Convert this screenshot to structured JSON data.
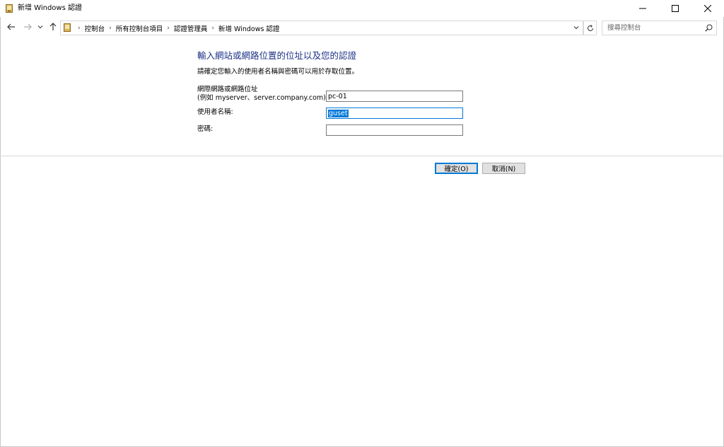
{
  "window": {
    "title": "新增 Windows 認證"
  },
  "nav": {
    "breadcrumbs": [
      "控制台",
      "所有控制台項目",
      "認證管理員",
      "新增 Windows 認證"
    ],
    "search_placeholder": "搜尋控制台"
  },
  "form": {
    "heading": "輸入網站或網路位置的位址以及您的認證",
    "subtitle": "請確定您輸入的使用者名稱與密碼可以用於存取位置。",
    "address_label_line1": "網際網路或網路位址",
    "address_label_line2": "(例如 myserver、server.company.com):",
    "address_value": "pc-01",
    "username_label": "使用者名稱:",
    "username_value": "guset",
    "password_label": "密碼:",
    "password_value": ""
  },
  "buttons": {
    "ok_label": "確定(O)",
    "cancel_label": "取消(N)"
  },
  "colors": {
    "heading": "#1e3287",
    "accent": "#0078d7"
  }
}
